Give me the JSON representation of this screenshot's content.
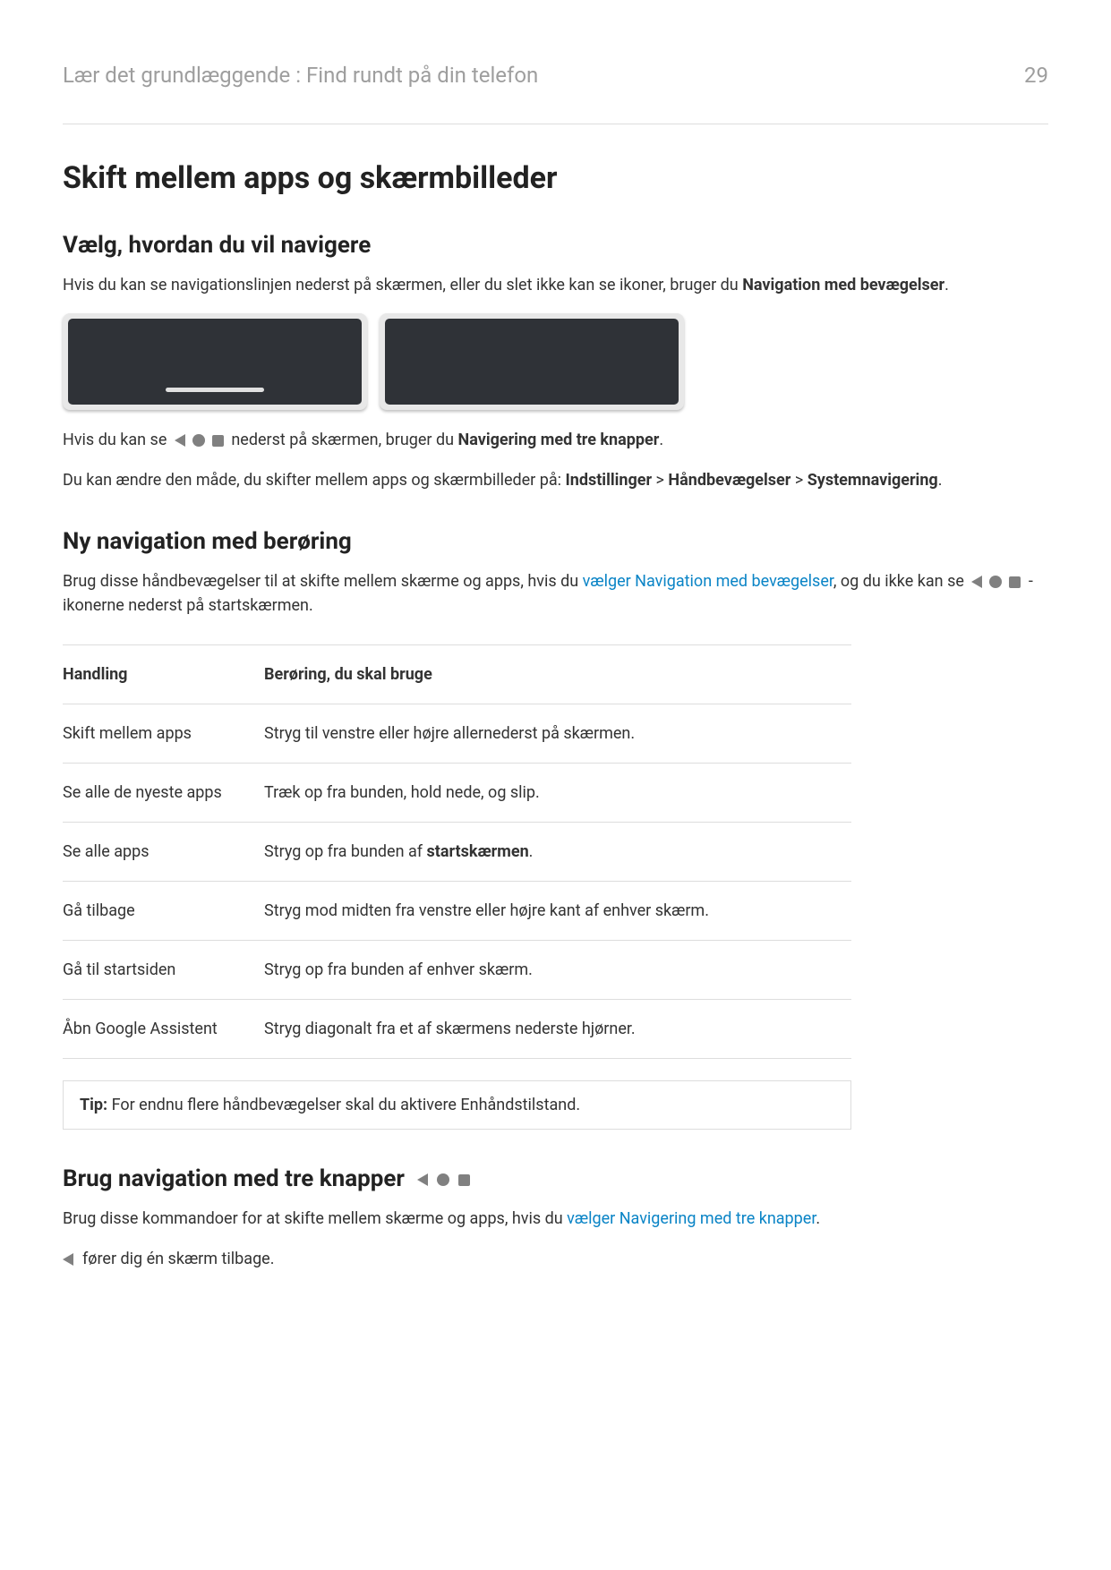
{
  "header": {
    "breadcrumb": "Lær det grundlæggende : Find rundt på din telefon",
    "page_number": "29"
  },
  "h1": "Skift mellem apps og skærmbilleder",
  "section1": {
    "heading": "Vælg, hvordan du vil navigere",
    "p1_a": "Hvis du kan se navigationslinjen nederst på skærmen, eller du slet ikke kan se ikoner, bruger du ",
    "p1_bold": "Navigation med bevægelser",
    "p1_b": ".",
    "p2_a": "Hvis du kan se ",
    "p2_b": " nederst på skærmen, bruger du ",
    "p2_bold": "Navigering med tre knapper",
    "p2_c": ".",
    "p3_a": "Du kan ændre den måde, du skifter mellem apps og skærmbilleder på: ",
    "p3_b1": "Indstillinger",
    "p3_gt1": " > ",
    "p3_b2": "Håndbevægelser",
    "p3_gt2": " > ",
    "p3_b3": "Systemnavigering",
    "p3_c": "."
  },
  "section2": {
    "heading": "Ny navigation med berøring",
    "p1_a": "Brug disse håndbevægelser til at skifte mellem skærme og apps, hvis du ",
    "p1_link": "vælger Navigation med bevægelser",
    "p1_b": ", og du ikke kan se ",
    "p1_c": "-ikonerne nederst på startskærmen.",
    "th1": "Handling",
    "th2": "Berøring, du skal bruge",
    "rows": [
      {
        "action": "Skift mellem apps",
        "touch": "Stryg til venstre eller højre allernederst på skærmen."
      },
      {
        "action": "Se alle de nyeste apps",
        "touch": "Træk op fra bunden, hold nede, og slip."
      },
      {
        "action": "Se alle apps",
        "touch_a": "Stryg op fra bunden af ",
        "touch_bold": "startskærmen",
        "touch_b": "."
      },
      {
        "action": "Gå tilbage",
        "touch": "Stryg mod midten fra venstre eller højre kant af enhver skærm."
      },
      {
        "action": "Gå til startsiden",
        "touch": "Stryg op fra bunden af enhver skærm."
      },
      {
        "action": "Åbn Google Assistent",
        "touch": "Stryg diagonalt fra et af skærmens nederste hjørner."
      }
    ],
    "tip_bold": "Tip:",
    "tip_text": " For endnu flere håndbevægelser skal du aktivere Enhåndstilstand."
  },
  "section3": {
    "heading": "Brug navigation med tre knapper",
    "p1_a": "Brug disse kommandoer for at skifte mellem skærme og apps, hvis du ",
    "p1_link": "vælger Navigering med tre knapper",
    "p1_b": ".",
    "back_text": " fører dig én skærm tilbage."
  }
}
